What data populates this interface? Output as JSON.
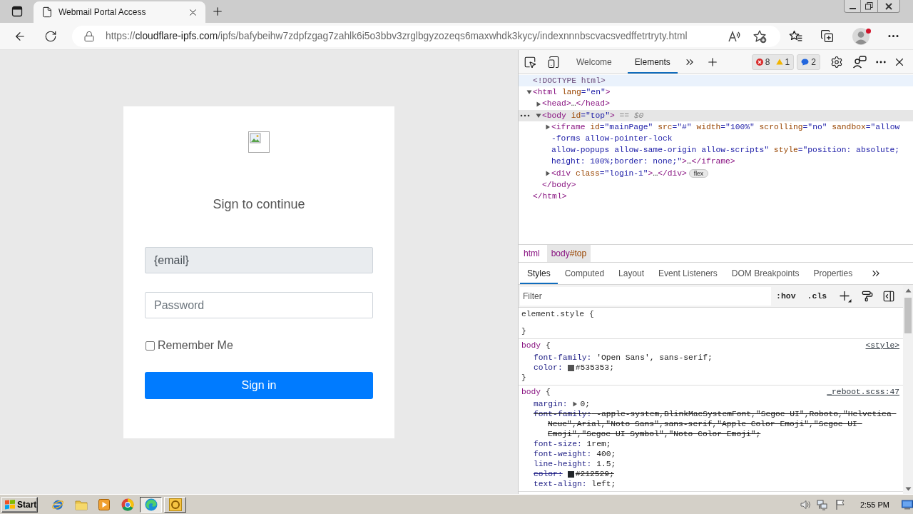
{
  "browser": {
    "tabs": [
      {
        "title": "Webmail Portal Access",
        "selected": true
      }
    ],
    "address_bar": {
      "scheme": "https://",
      "host": "cloudflare-ipfs.com",
      "path": "/ipfs/bafybeihw7zdpfzgag7zahlk6i5o3bbv3zrglbgyzozeqs6maxwhdk3kycy/indexnnnbscvacsvedffetrtryty.html"
    },
    "profile": {
      "notification": true
    }
  },
  "page": {
    "heading": "Sign to continue",
    "email_field": {
      "value": "{email}",
      "readonly": true
    },
    "password_field": {
      "placeholder": "Password"
    },
    "remember_me": {
      "label": "Remember Me",
      "checked": false
    },
    "sign_in_button": {
      "label": "Sign in"
    }
  },
  "devtools": {
    "tabs": [
      {
        "label": "Welcome",
        "selected": false
      },
      {
        "label": "Elements",
        "selected": true
      }
    ],
    "issues": {
      "errors": "8",
      "warnings": "1",
      "messages": "2"
    },
    "dom_tree": [
      {
        "lines": [
          [
            {
              "kind": "doctype",
              "text": "<!DOCTYPE html>"
            }
          ]
        ],
        "selected": false,
        "hovered": true
      },
      {
        "lines": [
          [
            {
              "kind": "tag",
              "text": "<html"
            },
            {
              "kind": "attr",
              "text": " lang"
            },
            {
              "kind": "value",
              "text": "=\"en\""
            },
            {
              "kind": "tag",
              "text": ">"
            }
          ]
        ],
        "expanded": true,
        "selected": false,
        "hovered": false,
        "children": [
          {
            "lines": [
              [
                {
                  "kind": "tag",
                  "text": "<head>"
                },
                {
                  "kind": "text",
                  "text": "…"
                },
                {
                  "kind": "tag",
                  "text": "</head>"
                }
              ]
            ],
            "expanded": false,
            "selected": false,
            "hovered": false
          },
          {
            "lines": [
              [
                {
                  "kind": "tag",
                  "text": "<body"
                },
                {
                  "kind": "attr",
                  "text": " id"
                },
                {
                  "kind": "value",
                  "text": "=\"top\""
                },
                {
                  "kind": "tag",
                  "text": ">"
                },
                {
                  "kind": "hint",
                  "text": " == $0"
                }
              ]
            ],
            "expanded": true,
            "selected": true,
            "hovered": false,
            "children": [
              {
                "lines": [
                  [
                    {
                      "kind": "tag",
                      "text": "<iframe"
                    },
                    {
                      "kind": "attr",
                      "text": " id"
                    },
                    {
                      "kind": "value",
                      "text": "=\"mainPage\""
                    },
                    {
                      "kind": "attr",
                      "text": " src"
                    },
                    {
                      "kind": "value",
                      "text": "=\"#\""
                    },
                    {
                      "kind": "attr",
                      "text": " width"
                    },
                    {
                      "kind": "value",
                      "text": "=\"100%\""
                    },
                    {
                      "kind": "attr",
                      "text": " scrolling"
                    },
                    {
                      "kind": "value",
                      "text": "=\"no\""
                    },
                    {
                      "kind": "attr",
                      "text": " sandbox"
                    },
                    {
                      "kind": "value",
                      "text": "=\"allow"
                    }
                  ],
                  [
                    {
                      "kind": "value",
                      "text": "-forms allow-pointer-lock"
                    }
                  ],
                  [
                    {
                      "kind": "value",
                      "text": "allow-popups allow-same-origin allow-scripts\""
                    },
                    {
                      "kind": "attr",
                      "text": " style"
                    },
                    {
                      "kind": "value",
                      "text": "=\"position: absolute;"
                    }
                  ],
                  [
                    {
                      "kind": "value",
                      "text": "height: 100%;border: none;\""
                    },
                    {
                      "kind": "tag",
                      "text": ">"
                    },
                    {
                      "kind": "text",
                      "text": "…"
                    },
                    {
                      "kind": "tag",
                      "text": "</iframe>"
                    }
                  ]
                ],
                "expanded": false,
                "selected": false,
                "hovered": false
              },
              {
                "lines": [
                  [
                    {
                      "kind": "tag",
                      "text": "<div"
                    },
                    {
                      "kind": "attr",
                      "text": " class"
                    },
                    {
                      "kind": "value",
                      "text": "=\"login-1\""
                    },
                    {
                      "kind": "tag",
                      "text": ">"
                    },
                    {
                      "kind": "text",
                      "text": "…"
                    },
                    {
                      "kind": "tag",
                      "text": "</div>"
                    }
                  ]
                ],
                "badge": "flex",
                "expanded": false,
                "selected": false,
                "hovered": false
              }
            ],
            "closing": [
              {
                "kind": "tag",
                "text": "</body>"
              }
            ]
          }
        ],
        "closing": [
          {
            "kind": "tag",
            "text": "</html>"
          }
        ]
      }
    ],
    "breadcrumbs": [
      {
        "tag": "html",
        "selected": false
      },
      {
        "tag": "body",
        "id": "#top",
        "selected": true
      }
    ],
    "pane_tabs": [
      {
        "label": "Styles",
        "selected": true
      },
      {
        "label": "Computed",
        "selected": false
      },
      {
        "label": "Layout",
        "selected": false
      },
      {
        "label": "Event Listeners",
        "selected": false
      },
      {
        "label": "DOM Breakpoints",
        "selected": false
      },
      {
        "label": "Properties",
        "selected": false
      }
    ],
    "filter": {
      "placeholder": "Filter",
      "toggles": [
        ":hov",
        ".cls"
      ]
    },
    "rules": [
      {
        "kind": "inline",
        "selector": "element.style",
        "open": " {",
        "close": "}"
      },
      {
        "kind": "rule",
        "selector": "body",
        "open": " {",
        "close": "}",
        "source": "<style>",
        "declarations": [
          {
            "kind": "plain",
            "property": "font-family:",
            "value": " 'Open Sans', sans-serif;",
            "overridden": false
          },
          {
            "kind": "color",
            "property": "color:",
            "color": "#535353",
            "value": "#535353;",
            "overridden": false
          }
        ]
      },
      {
        "kind": "rule",
        "selector": "body",
        "open": " {",
        "source": "_reboot.scss:47",
        "declarations": [
          {
            "kind": "shorthand",
            "property": "margin:",
            "value": "0;",
            "overridden": false
          },
          {
            "kind": "plain",
            "property": "font-family:",
            "value": " -apple-system,BlinkMacSystemFont,\"Segoe UI\",Roboto,\"Helvetica Neue\",Arial,\"Noto Sans\",sans-serif,\"Apple Color Emoji\",\"Segoe UI Emoji\",\"Segoe UI Symbol\",\"Noto Color Emoji\";",
            "overridden": true
          },
          {
            "kind": "plain",
            "property": "font-size:",
            "value": " 1rem;",
            "overridden": false
          },
          {
            "kind": "plain",
            "property": "font-weight:",
            "value": " 400;",
            "overridden": false
          },
          {
            "kind": "plain",
            "property": "line-height:",
            "value": " 1.5;",
            "overridden": false
          },
          {
            "kind": "color",
            "property": "color:",
            "color": "#212529",
            "value": "#212529;",
            "overridden": true
          },
          {
            "kind": "plain",
            "property": "text-align:",
            "value": " left;",
            "overridden": false
          }
        ]
      }
    ]
  },
  "taskbar": {
    "start": "Start",
    "task_buttons": [
      {
        "kind": "browser",
        "active": true
      },
      {
        "kind": "mail",
        "active": false
      }
    ],
    "clock": "2:55 PM"
  }
}
